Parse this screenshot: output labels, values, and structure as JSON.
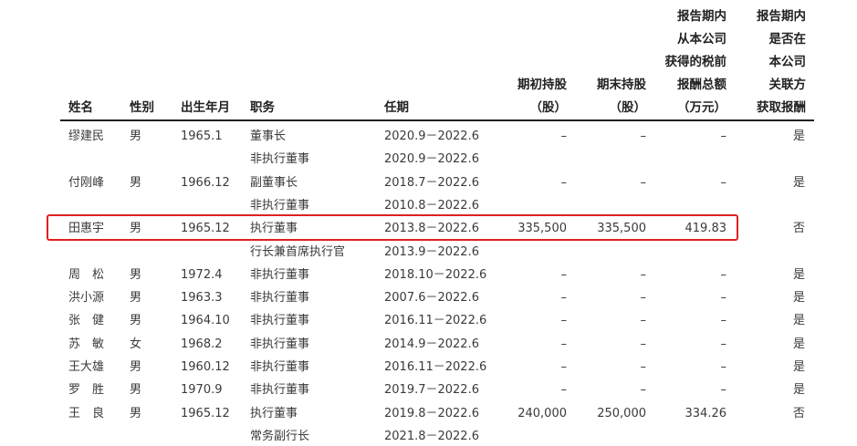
{
  "header": {
    "name": "姓名",
    "gender": "性别",
    "birth": "出生年月",
    "position": "职务",
    "term": "任期",
    "shares_begin": [
      "期初持股",
      "（股）"
    ],
    "shares_end": [
      "期末持股",
      "（股）"
    ],
    "remuneration": [
      "报告期内",
      "从本公司",
      "获得的税前",
      "报酬总额",
      "（万元）"
    ],
    "related_party": [
      "报告期内",
      "是否在",
      "本公司",
      "关联方",
      "获取报酬"
    ]
  },
  "rows": [
    {
      "name": "缪建民",
      "gender": "男",
      "birth": "1965.1",
      "position": "董事长",
      "term": "2020.9－2022.6",
      "shares_begin": "–",
      "shares_end": "–",
      "remuneration": "–",
      "related": "是"
    },
    {
      "name": "",
      "gender": "",
      "birth": "",
      "position": "非执行董事",
      "term": "2020.9－2022.6",
      "shares_begin": "",
      "shares_end": "",
      "remuneration": "",
      "related": ""
    },
    {
      "name": "付刚峰",
      "gender": "男",
      "birth": "1966.12",
      "position": "副董事长",
      "term": "2018.7－2022.6",
      "shares_begin": "–",
      "shares_end": "–",
      "remuneration": "–",
      "related": "是"
    },
    {
      "name": "",
      "gender": "",
      "birth": "",
      "position": "非执行董事",
      "term": "2010.8－2022.6",
      "shares_begin": "",
      "shares_end": "",
      "remuneration": "",
      "related": ""
    },
    {
      "name": "田惠宇",
      "gender": "男",
      "birth": "1965.12",
      "position": "执行董事",
      "term": "2013.8－2022.6",
      "shares_begin": "335,500",
      "shares_end": "335,500",
      "remuneration": "419.83",
      "related": "否"
    },
    {
      "name": "",
      "gender": "",
      "birth": "",
      "position": "行长兼首席执行官",
      "term": "2013.9－2022.6",
      "shares_begin": "",
      "shares_end": "",
      "remuneration": "",
      "related": ""
    },
    {
      "name": "周　松",
      "gender": "男",
      "birth": "1972.4",
      "position": "非执行董事",
      "term": "2018.10－2022.6",
      "shares_begin": "–",
      "shares_end": "–",
      "remuneration": "–",
      "related": "是"
    },
    {
      "name": "洪小源",
      "gender": "男",
      "birth": "1963.3",
      "position": "非执行董事",
      "term": "2007.6－2022.6",
      "shares_begin": "–",
      "shares_end": "–",
      "remuneration": "–",
      "related": "是"
    },
    {
      "name": "张　健",
      "gender": "男",
      "birth": "1964.10",
      "position": "非执行董事",
      "term": "2016.11－2022.6",
      "shares_begin": "–",
      "shares_end": "–",
      "remuneration": "–",
      "related": "是"
    },
    {
      "name": "苏　敏",
      "gender": "女",
      "birth": "1968.2",
      "position": "非执行董事",
      "term": "2014.9－2022.6",
      "shares_begin": "–",
      "shares_end": "–",
      "remuneration": "–",
      "related": "是"
    },
    {
      "name": "王大雄",
      "gender": "男",
      "birth": "1960.12",
      "position": "非执行董事",
      "term": "2016.11－2022.6",
      "shares_begin": "–",
      "shares_end": "–",
      "remuneration": "–",
      "related": "是"
    },
    {
      "name": "罗　胜",
      "gender": "男",
      "birth": "1970.9",
      "position": "非执行董事",
      "term": "2019.7－2022.6",
      "shares_begin": "–",
      "shares_end": "–",
      "remuneration": "–",
      "related": "是"
    },
    {
      "name": "王　良",
      "gender": "男",
      "birth": "1965.12",
      "position": "执行董事",
      "term": "2019.8－2022.6",
      "shares_begin": "240,000",
      "shares_end": "250,000",
      "remuneration": "334.26",
      "related": "否"
    },
    {
      "name": "",
      "gender": "",
      "birth": "",
      "position": "常务副行长",
      "term": "2021.8－2022.6",
      "shares_begin": "",
      "shares_end": "",
      "remuneration": "",
      "related": ""
    }
  ],
  "highlight": {
    "row_index": 4,
    "color": "#e02020"
  }
}
